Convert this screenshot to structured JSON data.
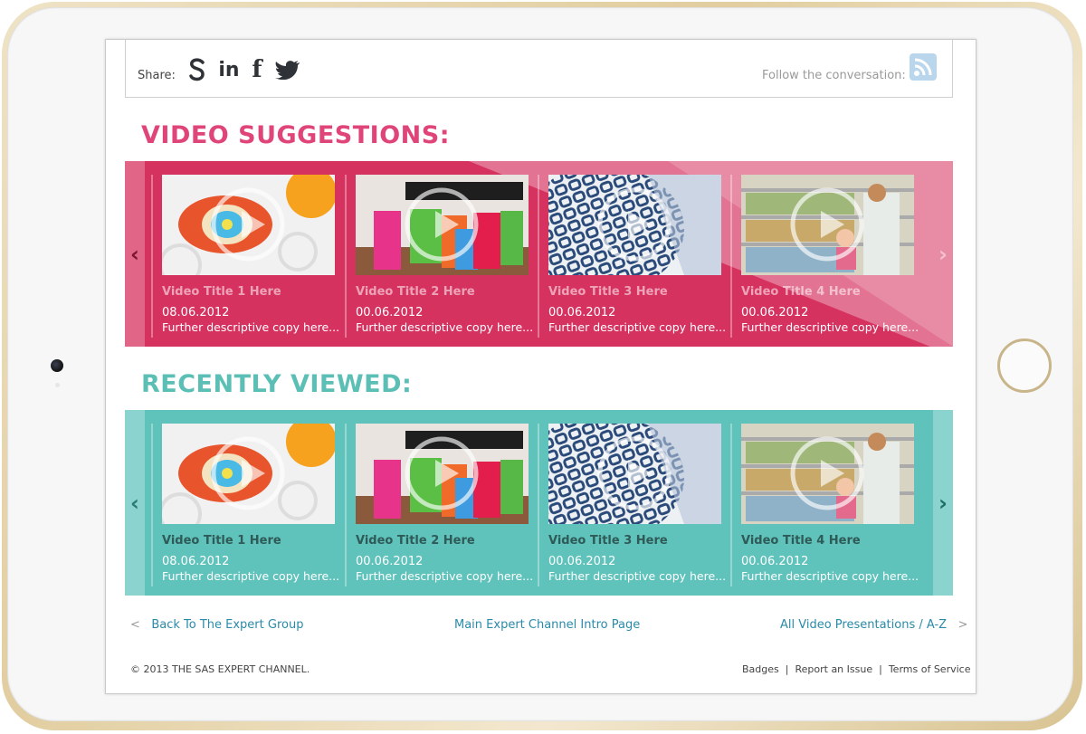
{
  "share": {
    "label": "Share:",
    "follow_text": "Follow the conversation:"
  },
  "share_icons": [
    "skype-icon",
    "linkedin-icon",
    "facebook-icon",
    "twitter-icon"
  ],
  "sections": {
    "suggestions": {
      "title": "VIDEO SUGGESTIONS:",
      "cards": [
        {
          "title": "Video Title 1 Here",
          "date": "08.06.2012",
          "desc": "Further descriptive copy here..."
        },
        {
          "title": "Video Title 2 Here",
          "date": "00.06.2012",
          "desc": "Further descriptive copy here..."
        },
        {
          "title": "Video Title 3 Here",
          "date": "00.06.2012",
          "desc": "Further descriptive copy here..."
        },
        {
          "title": "Video Title 4 Here",
          "date": "00.06.2012",
          "desc": "Further descriptive copy here..."
        }
      ]
    },
    "recent": {
      "title": "RECENTLY VIEWED:",
      "cards": [
        {
          "title": "Video Title 1 Here",
          "date": "08.06.2012",
          "desc": "Further descriptive copy here..."
        },
        {
          "title": "Video Title 2 Here",
          "date": "00.06.2012",
          "desc": "Further descriptive copy here..."
        },
        {
          "title": "Video Title 3 Here",
          "date": "00.06.2012",
          "desc": "Further descriptive copy here..."
        },
        {
          "title": "Video Title 4 Here",
          "date": "00.06.2012",
          "desc": "Further descriptive copy here..."
        }
      ]
    }
  },
  "arrows": {
    "prev": "‹",
    "next": "›",
    "lt": "<",
    "gt": ">"
  },
  "links": {
    "back": "Back To The Expert Group",
    "main": "Main Expert Channel Intro Page",
    "all": "All Video Presentations / A-Z"
  },
  "footer": {
    "copyright": "© 2013  THE SAS EXPERT CHANNEL.",
    "badges": "Badges",
    "report": "Report an Issue",
    "terms": "Terms of Service",
    "separator": "|"
  },
  "colors": {
    "pink": "#d6325f",
    "pink_title": "#e0457a",
    "teal": "#5fc2bb",
    "teal_title": "#5cbfb5",
    "link": "#2a8aa8"
  }
}
